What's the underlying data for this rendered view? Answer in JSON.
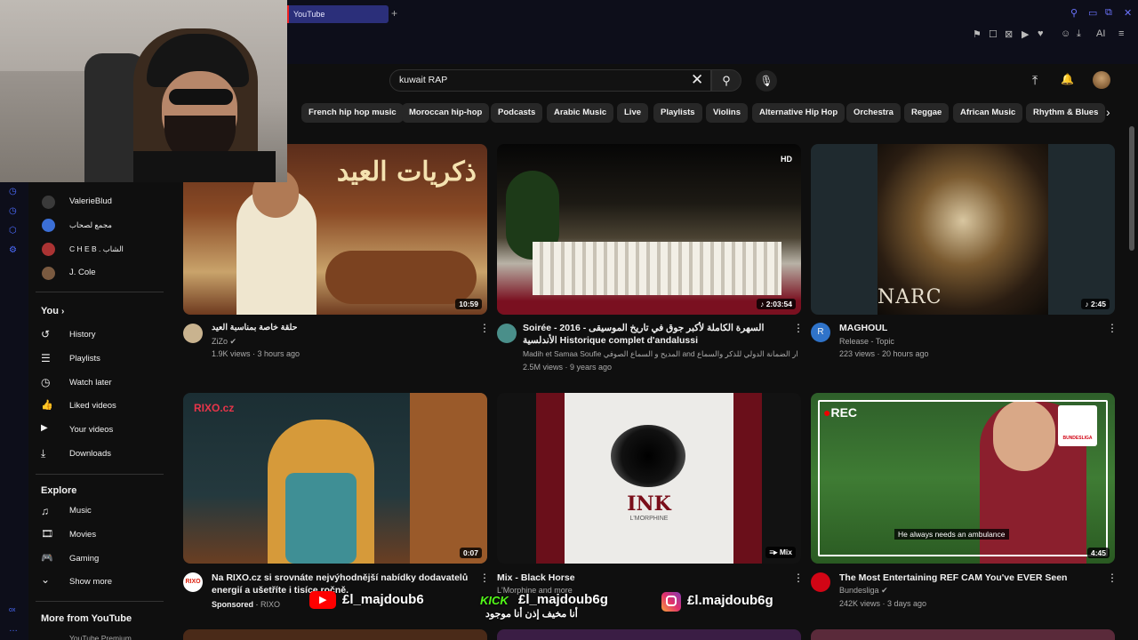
{
  "browser": {
    "tab_title": "YouTube",
    "new_tab_symbol": "+",
    "window_controls": [
      "⚲",
      "▭",
      "⧉",
      "✕"
    ],
    "toolbar_icons": [
      "⚑",
      "☐",
      "⊠",
      "▶",
      "♥",
      "➤",
      "☺",
      "⤓",
      "AI",
      "≡"
    ]
  },
  "header": {
    "search_value": "kuwait RAP",
    "upload_icon": "⤒",
    "bell_icon": "🔔"
  },
  "chips": [
    "French hip hop music",
    "Moroccan hip-hop",
    "Podcasts",
    "Arabic Music",
    "Live",
    "Playlists",
    "Violins",
    "Alternative Hip Hop",
    "Orchestra",
    "Reggae",
    "African Music",
    "Rhythm & Blues"
  ],
  "sidebar": {
    "subscriptions": [
      {
        "name": "ValerieBlud",
        "color": "#3a3a3a"
      },
      {
        "name": "مجمع لصحاب",
        "color": "#3b6fd6"
      },
      {
        "name": "C H E B . الشاب",
        "color": "#a33"
      },
      {
        "name": "J. Cole",
        "color": "#7a5a40"
      }
    ],
    "you_heading": "You",
    "you_items": [
      {
        "icon": "history-icon",
        "glyph": "↺",
        "label": "History"
      },
      {
        "icon": "playlists-icon",
        "glyph": "☰",
        "label": "Playlists"
      },
      {
        "icon": "watch-later-icon",
        "glyph": "◷",
        "label": "Watch later"
      },
      {
        "icon": "like-icon",
        "glyph": "👍",
        "label": "Liked videos"
      },
      {
        "icon": "your-videos-icon",
        "glyph": "▶",
        "label": "Your videos"
      },
      {
        "icon": "download-icon",
        "glyph": "⤓",
        "label": "Downloads"
      }
    ],
    "explore_heading": "Explore",
    "explore_items": [
      {
        "icon": "music-icon",
        "glyph": "♫",
        "label": "Music"
      },
      {
        "icon": "movies-icon",
        "glyph": "🎞",
        "label": "Movies"
      },
      {
        "icon": "gaming-icon",
        "glyph": "🎮",
        "label": "Gaming"
      },
      {
        "icon": "chevron-down-icon",
        "glyph": "⌄",
        "label": "Show more"
      }
    ],
    "more_heading": "More from YouTube",
    "more_first": "YouTube Premium"
  },
  "videos": [
    {
      "title": "حلقة خاصة بمناسبة العيد",
      "channel": "ZiZo",
      "verified": true,
      "meta": "1.9K views · 3 hours ago",
      "duration": "10:59",
      "thumb_text": "ذكريات العيد",
      "avatar_color": "#c9b38f"
    },
    {
      "title": "Soirée - 2016 - السهرة الكاملة لأكبر جوق في تاريخ الموسيقى الأندلسية Historique complet d'andalussi",
      "channel": "Madih et Samaa Soufie المديح و السماع الصوفي and ملتقى دار الضمانة الدولي للذكر والسماع",
      "verified": false,
      "meta": "2.5M views · 9 years ago",
      "duration": "♪ 2:03:54",
      "thumb_text": "",
      "avatar_color": "#4a8f8a"
    },
    {
      "title": "MAGHOUL",
      "channel": "Release - Topic",
      "verified": false,
      "meta": "223 views · 20 hours ago",
      "duration": "♪ 2:45",
      "thumb_text": "NARC",
      "avatar_color": "#2f73c9",
      "avatar_letter": "R"
    },
    {
      "title": "Na RIXO.cz si srovnáte nejvýhodnější nabídky dodavatelů energií a ušetříte i tisíce ročně.",
      "channel": "RIXO",
      "sponsored_label": "Sponsored",
      "meta": "",
      "duration": "0:07",
      "thumb_text": "RIXO.cz",
      "avatar_color": "#ffffff"
    },
    {
      "title": "Mix - Black Horse",
      "channel": "L'Morphine and more",
      "verified": false,
      "meta": "",
      "duration": "Mix",
      "thumb_text": "INK",
      "thumb_sub": "L'MORPHINE",
      "avatar_color": "#000"
    },
    {
      "title": "The Most Entertaining REF CAM You've EVER Seen",
      "channel": "Bundesliga",
      "verified": true,
      "meta": "242K views · 3 days ago",
      "duration": "4:45",
      "thumb_text": "REC",
      "thumb_caption": "He always needs an ambulance",
      "thumb_badge": "BUNDESLIGA",
      "avatar_color": "#d20515"
    }
  ],
  "overlays": {
    "youtube_handle": "£l_majdoub6",
    "kick_label": "KICK",
    "kick_handle": "£l_majdoub6g",
    "kick_arabic": "أنا مخيف إذن أنا موجود",
    "instagram_handle": "£l.majdoub6g"
  },
  "colors": {
    "accent": "#ff0000",
    "chip_bg": "#272727",
    "bg": "#0f0f0f"
  }
}
